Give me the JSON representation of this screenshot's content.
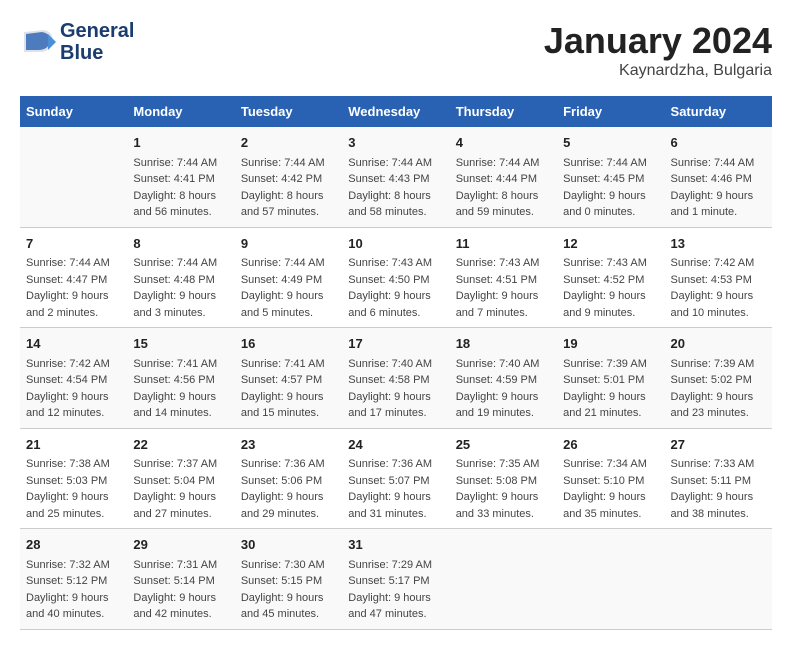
{
  "header": {
    "logo_line1": "General",
    "logo_line2": "Blue",
    "month": "January 2024",
    "location": "Kaynardzha, Bulgaria"
  },
  "weekdays": [
    "Sunday",
    "Monday",
    "Tuesday",
    "Wednesday",
    "Thursday",
    "Friday",
    "Saturday"
  ],
  "weeks": [
    [
      {
        "day": "",
        "info": ""
      },
      {
        "day": "1",
        "info": "Sunrise: 7:44 AM\nSunset: 4:41 PM\nDaylight: 8 hours\nand 56 minutes."
      },
      {
        "day": "2",
        "info": "Sunrise: 7:44 AM\nSunset: 4:42 PM\nDaylight: 8 hours\nand 57 minutes."
      },
      {
        "day": "3",
        "info": "Sunrise: 7:44 AM\nSunset: 4:43 PM\nDaylight: 8 hours\nand 58 minutes."
      },
      {
        "day": "4",
        "info": "Sunrise: 7:44 AM\nSunset: 4:44 PM\nDaylight: 8 hours\nand 59 minutes."
      },
      {
        "day": "5",
        "info": "Sunrise: 7:44 AM\nSunset: 4:45 PM\nDaylight: 9 hours\nand 0 minutes."
      },
      {
        "day": "6",
        "info": "Sunrise: 7:44 AM\nSunset: 4:46 PM\nDaylight: 9 hours\nand 1 minute."
      }
    ],
    [
      {
        "day": "7",
        "info": "Sunrise: 7:44 AM\nSunset: 4:47 PM\nDaylight: 9 hours\nand 2 minutes."
      },
      {
        "day": "8",
        "info": "Sunrise: 7:44 AM\nSunset: 4:48 PM\nDaylight: 9 hours\nand 3 minutes."
      },
      {
        "day": "9",
        "info": "Sunrise: 7:44 AM\nSunset: 4:49 PM\nDaylight: 9 hours\nand 5 minutes."
      },
      {
        "day": "10",
        "info": "Sunrise: 7:43 AM\nSunset: 4:50 PM\nDaylight: 9 hours\nand 6 minutes."
      },
      {
        "day": "11",
        "info": "Sunrise: 7:43 AM\nSunset: 4:51 PM\nDaylight: 9 hours\nand 7 minutes."
      },
      {
        "day": "12",
        "info": "Sunrise: 7:43 AM\nSunset: 4:52 PM\nDaylight: 9 hours\nand 9 minutes."
      },
      {
        "day": "13",
        "info": "Sunrise: 7:42 AM\nSunset: 4:53 PM\nDaylight: 9 hours\nand 10 minutes."
      }
    ],
    [
      {
        "day": "14",
        "info": "Sunrise: 7:42 AM\nSunset: 4:54 PM\nDaylight: 9 hours\nand 12 minutes."
      },
      {
        "day": "15",
        "info": "Sunrise: 7:41 AM\nSunset: 4:56 PM\nDaylight: 9 hours\nand 14 minutes."
      },
      {
        "day": "16",
        "info": "Sunrise: 7:41 AM\nSunset: 4:57 PM\nDaylight: 9 hours\nand 15 minutes."
      },
      {
        "day": "17",
        "info": "Sunrise: 7:40 AM\nSunset: 4:58 PM\nDaylight: 9 hours\nand 17 minutes."
      },
      {
        "day": "18",
        "info": "Sunrise: 7:40 AM\nSunset: 4:59 PM\nDaylight: 9 hours\nand 19 minutes."
      },
      {
        "day": "19",
        "info": "Sunrise: 7:39 AM\nSunset: 5:01 PM\nDaylight: 9 hours\nand 21 minutes."
      },
      {
        "day": "20",
        "info": "Sunrise: 7:39 AM\nSunset: 5:02 PM\nDaylight: 9 hours\nand 23 minutes."
      }
    ],
    [
      {
        "day": "21",
        "info": "Sunrise: 7:38 AM\nSunset: 5:03 PM\nDaylight: 9 hours\nand 25 minutes."
      },
      {
        "day": "22",
        "info": "Sunrise: 7:37 AM\nSunset: 5:04 PM\nDaylight: 9 hours\nand 27 minutes."
      },
      {
        "day": "23",
        "info": "Sunrise: 7:36 AM\nSunset: 5:06 PM\nDaylight: 9 hours\nand 29 minutes."
      },
      {
        "day": "24",
        "info": "Sunrise: 7:36 AM\nSunset: 5:07 PM\nDaylight: 9 hours\nand 31 minutes."
      },
      {
        "day": "25",
        "info": "Sunrise: 7:35 AM\nSunset: 5:08 PM\nDaylight: 9 hours\nand 33 minutes."
      },
      {
        "day": "26",
        "info": "Sunrise: 7:34 AM\nSunset: 5:10 PM\nDaylight: 9 hours\nand 35 minutes."
      },
      {
        "day": "27",
        "info": "Sunrise: 7:33 AM\nSunset: 5:11 PM\nDaylight: 9 hours\nand 38 minutes."
      }
    ],
    [
      {
        "day": "28",
        "info": "Sunrise: 7:32 AM\nSunset: 5:12 PM\nDaylight: 9 hours\nand 40 minutes."
      },
      {
        "day": "29",
        "info": "Sunrise: 7:31 AM\nSunset: 5:14 PM\nDaylight: 9 hours\nand 42 minutes."
      },
      {
        "day": "30",
        "info": "Sunrise: 7:30 AM\nSunset: 5:15 PM\nDaylight: 9 hours\nand 45 minutes."
      },
      {
        "day": "31",
        "info": "Sunrise: 7:29 AM\nSunset: 5:17 PM\nDaylight: 9 hours\nand 47 minutes."
      },
      {
        "day": "",
        "info": ""
      },
      {
        "day": "",
        "info": ""
      },
      {
        "day": "",
        "info": ""
      }
    ]
  ]
}
